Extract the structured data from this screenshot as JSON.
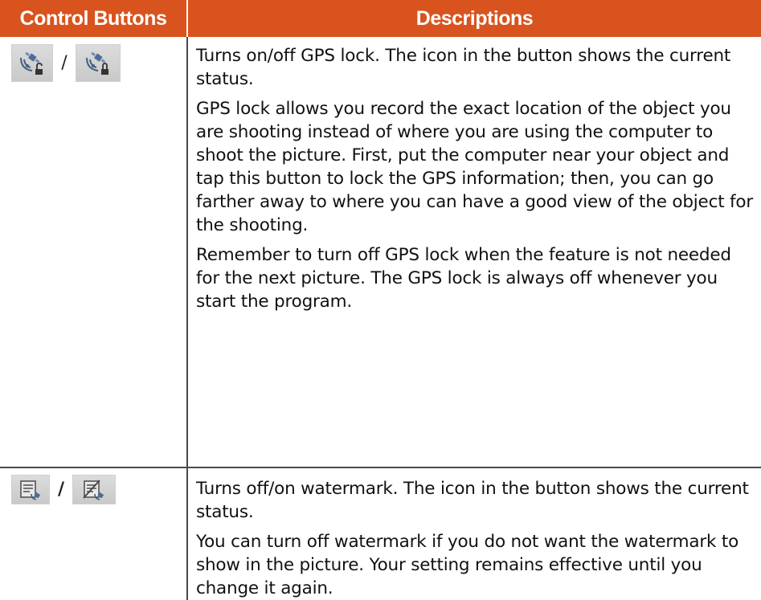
{
  "header": {
    "col1": "Control Buttons",
    "col2": "Descriptions"
  },
  "rows": [
    {
      "icons": [
        "gps-unlocked-icon",
        "gps-locked-icon"
      ],
      "separator": "/",
      "paragraphs": [
        "Turns on/off GPS lock. The icon in the button shows the current status.",
        "GPS lock allows you record the exact location of the object you are shooting instead of where you are using the computer to shoot the picture. First, put the computer near your object and tap this button to lock the GPS information; then, you can go farther away to where you can have a good view of the object for the shooting.",
        "Remember to turn off GPS lock when the feature is not needed for the next picture. The GPS lock is always off whenever you start the program."
      ]
    },
    {
      "icons": [
        "watermark-on-icon",
        "watermark-off-icon"
      ],
      "separator": "/",
      "paragraphs": [
        "Turns off/on watermark. The icon in the button shows the current status.",
        "You can turn off watermark if you do not want the watermark to show in the picture. Your setting remains effective until you change it again."
      ]
    }
  ],
  "colors": {
    "header_bg": "#d9531e",
    "header_text": "#ffffff",
    "rule": "#4a4a4a",
    "button_bg": "#d4d4d4"
  }
}
